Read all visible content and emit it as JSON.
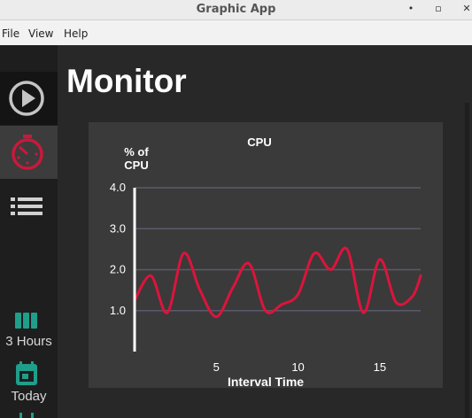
{
  "window": {
    "title": "Graphic App",
    "minimize": "•",
    "maximize": "▫",
    "close": "✕"
  },
  "menu": {
    "items": [
      "File",
      "View",
      "Help"
    ]
  },
  "sidebar": {
    "buttons": [
      {
        "icon": "play-circle-icon"
      },
      {
        "icon": "timer-icon"
      },
      {
        "icon": "list-icon"
      }
    ],
    "ranges": [
      {
        "icon": "bar-chart-icon",
        "label": "3 Hours"
      },
      {
        "icon": "calendar-icon",
        "label": "Today"
      }
    ]
  },
  "page": {
    "title": "Monitor"
  },
  "colors": {
    "accent": "#c8193c",
    "teal": "#1f9e8a",
    "panel": "#3a3a3a"
  },
  "chart_data": {
    "type": "line",
    "title": "CPU",
    "ylabel_line1": "% of",
    "ylabel_line2": "CPU",
    "xlabel": "Interval Time",
    "xlim": [
      0,
      17.5
    ],
    "ylim": [
      0,
      4.0
    ],
    "yticks": [
      "1.0",
      "2.0",
      "3.0",
      "4.0"
    ],
    "xticks": [
      "5",
      "10",
      "15"
    ],
    "grid": true,
    "series": [
      {
        "color": "#dc143c",
        "x": [
          0,
          1,
          2,
          3,
          4,
          5,
          6,
          7,
          8,
          9,
          10,
          11,
          12,
          13,
          14,
          15,
          16,
          17,
          17.5
        ],
        "y": [
          1.25,
          1.85,
          0.95,
          2.4,
          1.5,
          0.85,
          1.55,
          2.15,
          1.0,
          1.15,
          1.4,
          2.4,
          2.0,
          2.5,
          0.95,
          2.25,
          1.2,
          1.35,
          1.85
        ]
      }
    ]
  }
}
